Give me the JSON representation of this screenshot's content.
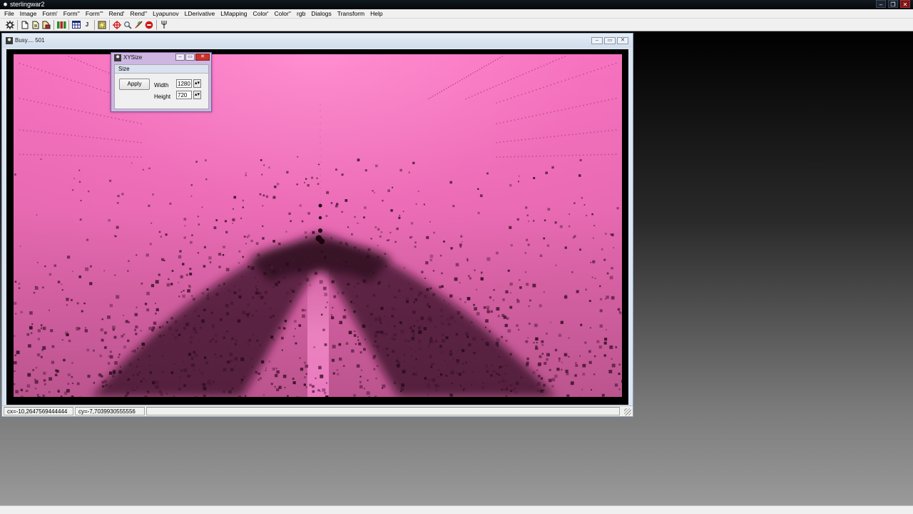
{
  "app": {
    "title": "sterlingwar2"
  },
  "menu": {
    "items": [
      "File",
      "Image",
      "Form'",
      "Form''",
      "Form'''",
      "Rend'",
      "Rend''",
      "Lyapunov",
      "LDerivative",
      "LMapping",
      "Color'",
      "Color''",
      "rgb",
      "Dialogs",
      "Transform",
      "Help"
    ]
  },
  "toolbar": {
    "icons": [
      "settings-icon",
      "new-icon",
      "open-icon",
      "save-icon",
      "palette-icon",
      "grid-icon",
      "j-icon",
      "select-icon",
      "crosshair-icon",
      "zoom-icon",
      "brush-icon",
      "stop-icon",
      "pitchfork-icon"
    ],
    "j_label": "J"
  },
  "child_window": {
    "title": "Busy.... 501"
  },
  "status": {
    "cx": "cx=-10,2647569444444",
    "cy": "cy=-7,7039930555556"
  },
  "dialog": {
    "title": "XYSize",
    "group_label": "Size",
    "apply_label": "Apply",
    "width_label": "Width",
    "width_value": "1280",
    "height_label": "Height",
    "height_value": "720"
  },
  "colors": {
    "fractal_pink": "#ff7fc6",
    "fractal_dark": "#2a0a1c",
    "dialog_frame": "#cdb7e2"
  }
}
